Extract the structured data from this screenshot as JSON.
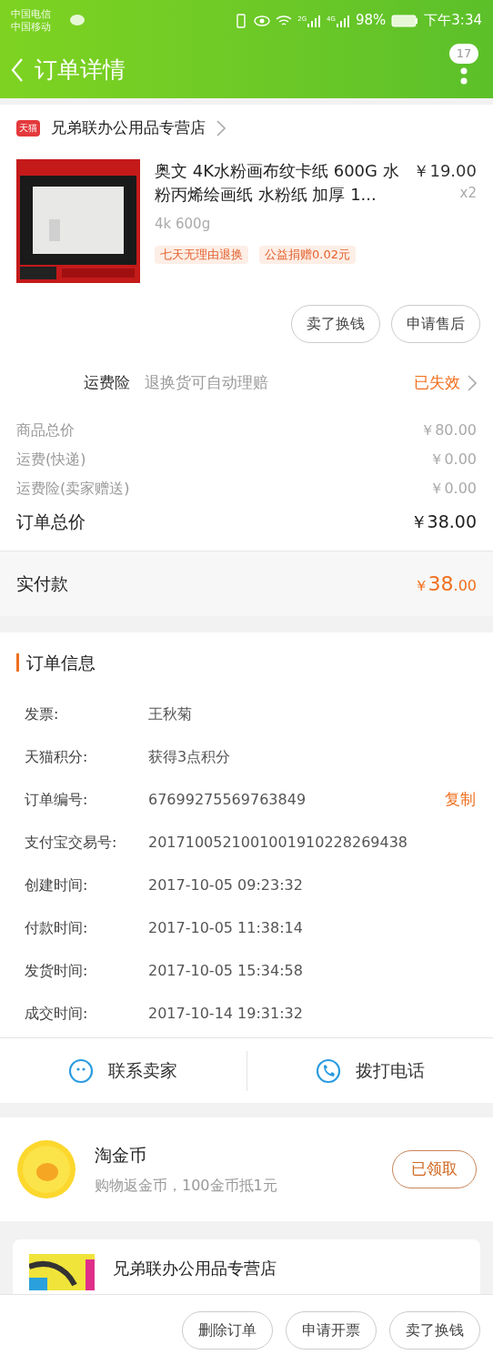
{
  "status_bar": {
    "carriers": [
      "中国电信",
      "中国移动"
    ],
    "network_labels": [
      "2G",
      "4G"
    ],
    "battery": "98%",
    "time": "下午3:34"
  },
  "header": {
    "title": "订单详情",
    "badge": "17"
  },
  "shop": {
    "name": "兄弟联办公用品专营店",
    "badge": "天猫"
  },
  "product": {
    "title": "奥文 4K水粉画布纹卡纸 600G 水粉丙烯绘画纸 水粉纸 加厚 1...",
    "price": "￥19.00",
    "quantity": "x2",
    "spec": "4k 600g",
    "tags": [
      "七天无理由退换",
      "公益捐赠0.02元"
    ]
  },
  "item_actions": [
    "卖了换钱",
    "申请售后"
  ],
  "insurance": {
    "label": "运费险",
    "description": "退换货可自动理赔",
    "status": "已失效"
  },
  "price_rows": [
    {
      "label": "商品总价",
      "value": "￥80.00",
      "kind": "minor"
    },
    {
      "label": "运费(快递)",
      "value": "￥0.00",
      "kind": "minor"
    },
    {
      "label": "运费险(卖家赠送)",
      "value": "￥0.00",
      "kind": "minor"
    },
    {
      "label": "订单总价",
      "value": "￥38.00",
      "kind": "major"
    }
  ],
  "paid": {
    "label": "实付款",
    "currency": "￥",
    "amount": "38",
    "decimals": ".00"
  },
  "order_info": {
    "title": "订单信息",
    "rows": [
      {
        "label": "发票:",
        "value": "王秋菊"
      },
      {
        "label": "天猫积分:",
        "value": "获得3点积分"
      },
      {
        "label": "订单编号:",
        "value": "67699275569763849",
        "action": "复制"
      },
      {
        "label": "支付宝交易号:",
        "value": "2017100521001001910228269438"
      },
      {
        "label": "创建时间:",
        "value": "2017-10-05 09:23:32"
      },
      {
        "label": "付款时间:",
        "value": "2017-10-05 11:38:14"
      },
      {
        "label": "发货时间:",
        "value": "2017-10-05 15:34:58"
      },
      {
        "label": "成交时间:",
        "value": "2017-10-14 19:31:32"
      }
    ]
  },
  "contact": [
    "联系卖家",
    "拨打电话"
  ],
  "coins": {
    "title": "淘金币",
    "subtitle": "购物返金币，100金币抵1元",
    "button": "已领取"
  },
  "next_shop": {
    "name": "兄弟联办公用品专营店"
  },
  "bottom_actions": [
    "删除订单",
    "申请开票",
    "卖了换钱"
  ]
}
